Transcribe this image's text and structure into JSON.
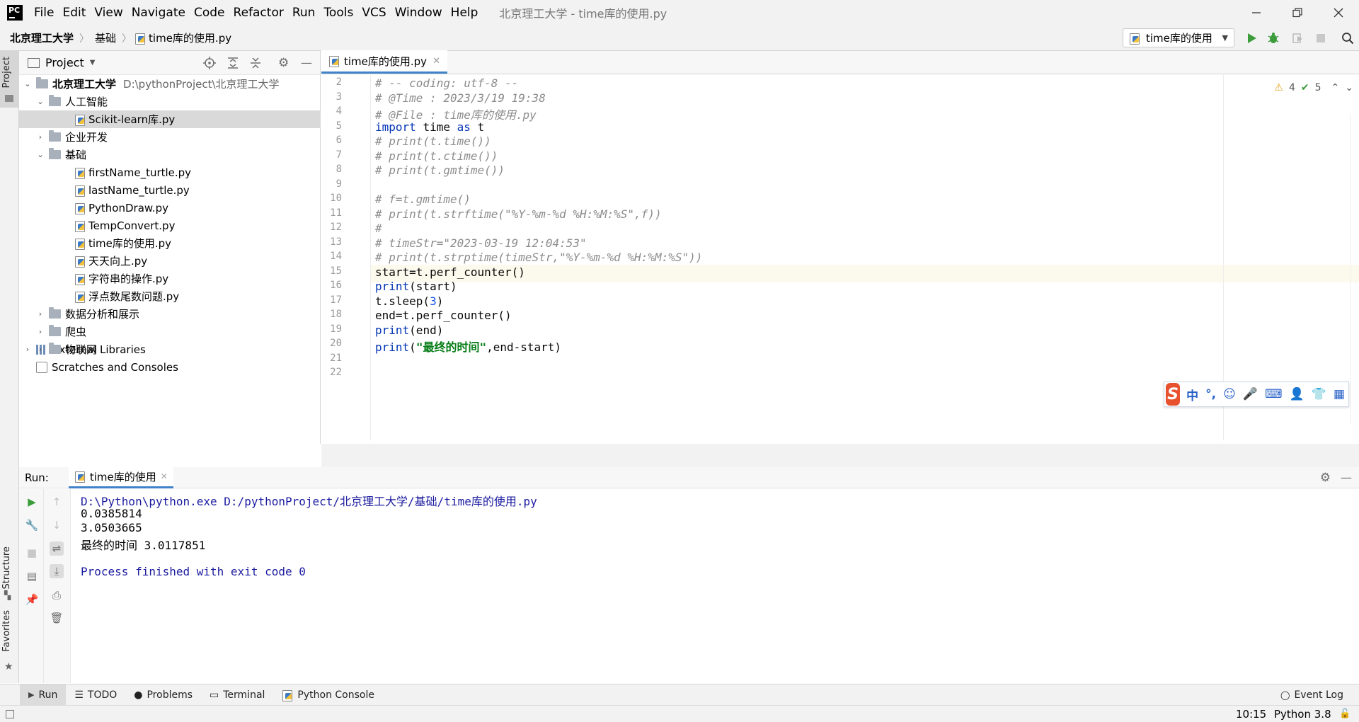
{
  "menubar": {
    "items": [
      "File",
      "Edit",
      "View",
      "Navigate",
      "Code",
      "Refactor",
      "Run",
      "Tools",
      "VCS",
      "Window",
      "Help"
    ],
    "window_title": "北京理工大学 - time库的使用.py"
  },
  "navbar": {
    "crumbs": [
      "北京理工大学",
      "基础",
      "time库的使用.py"
    ],
    "run_config": "time库的使用"
  },
  "sidebar": {
    "project_tab": "Project",
    "structure_tab": "Structure",
    "favorites_tab": "Favorites"
  },
  "project": {
    "header": "Project",
    "root_name": "北京理工大学",
    "root_path": "D:\\pythonProject\\北京理工大学",
    "tree": [
      {
        "label": "人工智能",
        "type": "folder",
        "depth": 1,
        "arrow": "open"
      },
      {
        "label": "Scikit-learn库.py",
        "type": "file",
        "depth": 2,
        "selected": true
      },
      {
        "label": "企业开发",
        "type": "folder",
        "depth": 1,
        "arrow": "closed"
      },
      {
        "label": "基础",
        "type": "folder",
        "depth": 1,
        "arrow": "open"
      },
      {
        "label": "firstName_turtle.py",
        "type": "file",
        "depth": 2
      },
      {
        "label": "lastName_turtle.py",
        "type": "file",
        "depth": 2
      },
      {
        "label": "PythonDraw.py",
        "type": "file",
        "depth": 2
      },
      {
        "label": "TempConvert.py",
        "type": "file",
        "depth": 2
      },
      {
        "label": "time库的使用.py",
        "type": "file",
        "depth": 2
      },
      {
        "label": "天天向上.py",
        "type": "file",
        "depth": 2
      },
      {
        "label": "字符串的操作.py",
        "type": "file",
        "depth": 2
      },
      {
        "label": "浮点数尾数问题.py",
        "type": "file",
        "depth": 2
      },
      {
        "label": "数据分析和展示",
        "type": "folder",
        "depth": 1,
        "arrow": "closed"
      },
      {
        "label": "爬虫",
        "type": "folder",
        "depth": 1,
        "arrow": "closed"
      },
      {
        "label": "物联网",
        "type": "folder",
        "depth": 1,
        "arrow": "closed"
      }
    ],
    "external_libraries": "External Libraries",
    "scratches": "Scratches and Consoles"
  },
  "editor": {
    "tab": "time库的使用.py",
    "warnings": "4",
    "checks": "5",
    "lines": [
      {
        "n": "2",
        "segs": [
          [
            "cm",
            "# -- coding: utf-8 --"
          ]
        ]
      },
      {
        "n": "3",
        "segs": [
          [
            "cm",
            "# @Time : 2023/3/19 19:38"
          ]
        ]
      },
      {
        "n": "4",
        "segs": [
          [
            "cm",
            "# @File : time库的使用.py"
          ]
        ]
      },
      {
        "n": "5",
        "segs": [
          [
            "kw",
            "import "
          ],
          [
            "id",
            "time "
          ],
          [
            "kw",
            "as "
          ],
          [
            "id",
            "t"
          ]
        ]
      },
      {
        "n": "6",
        "segs": [
          [
            "cm",
            "# print(t.time())"
          ]
        ]
      },
      {
        "n": "7",
        "segs": [
          [
            "cm",
            "# print(t.ctime())"
          ]
        ]
      },
      {
        "n": "8",
        "segs": [
          [
            "cm",
            "# print(t.gmtime())"
          ]
        ]
      },
      {
        "n": "9",
        "segs": []
      },
      {
        "n": "10",
        "segs": [
          [
            "cm",
            "# f=t.gmtime()"
          ]
        ]
      },
      {
        "n": "11",
        "segs": [
          [
            "cm",
            "# print(t.strftime(\"%Y-%m-%d %H:%M:%S\",f))"
          ]
        ]
      },
      {
        "n": "12",
        "segs": [
          [
            "cm",
            "#"
          ]
        ]
      },
      {
        "n": "13",
        "segs": [
          [
            "cm",
            "# timeStr=\"2023-03-19 12:04:53\""
          ]
        ]
      },
      {
        "n": "14",
        "segs": [
          [
            "cm",
            "# print(t.strptime(timeStr,\"%Y-%m-%d %H:%M:%S\"))"
          ]
        ]
      },
      {
        "n": "15",
        "segs": [
          [
            "id",
            "start=t.perf_counter()"
          ]
        ]
      },
      {
        "n": "16",
        "segs": [
          [
            "kw",
            "print"
          ],
          [
            "id",
            "(start)"
          ]
        ]
      },
      {
        "n": "17",
        "segs": [
          [
            "id",
            "t.sleep("
          ],
          [
            "num",
            "3"
          ],
          [
            "id",
            ")"
          ]
        ]
      },
      {
        "n": "18",
        "segs": [
          [
            "id",
            "end=t.perf_counter()"
          ]
        ]
      },
      {
        "n": "19",
        "segs": [
          [
            "kw",
            "print"
          ],
          [
            "id",
            "(end)"
          ]
        ]
      },
      {
        "n": "20",
        "segs": [
          [
            "kw",
            "print"
          ],
          [
            "id",
            "("
          ],
          [
            "str",
            "\"最终的时间\""
          ],
          [
            "id",
            ",end-start)"
          ]
        ]
      },
      {
        "n": "21",
        "segs": []
      },
      {
        "n": "22",
        "segs": []
      }
    ]
  },
  "ime": {
    "logo": "S",
    "items": [
      "中",
      "°,",
      "☺",
      "🎤",
      "⌨",
      "👤",
      "👕",
      "▦"
    ]
  },
  "run": {
    "label": "Run:",
    "tab": "time库的使用",
    "output": [
      {
        "text": "D:\\Python\\python.exe D:/pythonProject/北京理工大学/基础/time库的使用.py",
        "blue": true
      },
      {
        "text": "0.0385814",
        "blue": false
      },
      {
        "text": "3.0503665",
        "blue": false
      },
      {
        "text": "最终的时间 3.0117851",
        "blue": false
      },
      {
        "text": "",
        "blue": false
      },
      {
        "text": "Process finished with exit code 0",
        "blue": true
      }
    ]
  },
  "bottom": {
    "tabs": [
      "Run",
      "TODO",
      "Problems",
      "Terminal",
      "Python Console"
    ],
    "event_log": "Event Log"
  },
  "status": {
    "position": "10:15",
    "interpreter": "Python 3.8"
  }
}
